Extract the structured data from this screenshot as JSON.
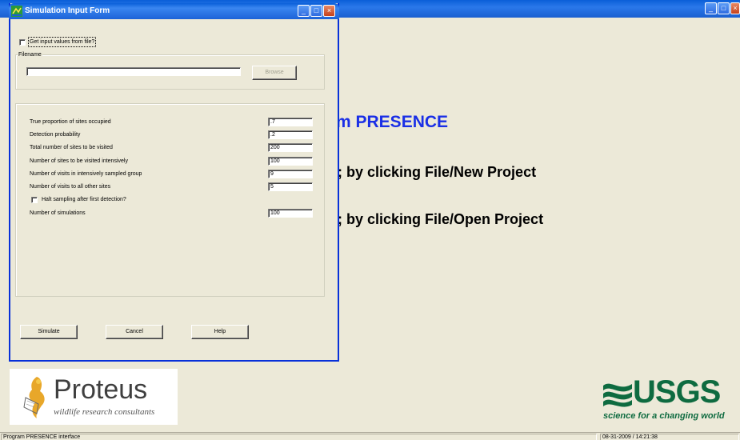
{
  "main_window": {
    "welcome_text": "m PRESENCE",
    "new_project_text": "; by clicking File/New Project",
    "open_project_text": "; by clicking File/Open Project"
  },
  "dialog": {
    "title": "Simulation Input Form",
    "get_input_label": "Get input values from file?",
    "filename_group_label": "Filename",
    "filename_value": "",
    "browse_label": "Browse",
    "fields": [
      {
        "label": "True proportion of sites occupied",
        "value": ".7"
      },
      {
        "label": "Detection probability",
        "value": ".2"
      },
      {
        "label": "Total number of sites to be visited",
        "value": "200"
      },
      {
        "label": "Number of sites to be visited intensively",
        "value": "100"
      },
      {
        "label": "Number of visits in intensively sampled group",
        "value": "9"
      },
      {
        "label": "Number of visits to all other sites",
        "value": "5"
      }
    ],
    "halt_label": "Halt sampling after first detection?",
    "num_sims_label": "Number of simulations",
    "num_sims_value": "100",
    "simulate_label": "Simulate",
    "cancel_label": "Cancel",
    "help_label": "Help"
  },
  "logos": {
    "proteus_name": "Proteus",
    "proteus_tagline": "wildlife research consultants",
    "usgs_name": "USGS",
    "usgs_tagline": "science for a changing world"
  },
  "statusbar": {
    "left_text": "Program PRESENCE interface",
    "right_text": "08-31-2009 / 14:21:38"
  },
  "icons": {
    "minimize": "minimize-icon",
    "maximize": "maximize-icon",
    "close": "close-icon"
  }
}
